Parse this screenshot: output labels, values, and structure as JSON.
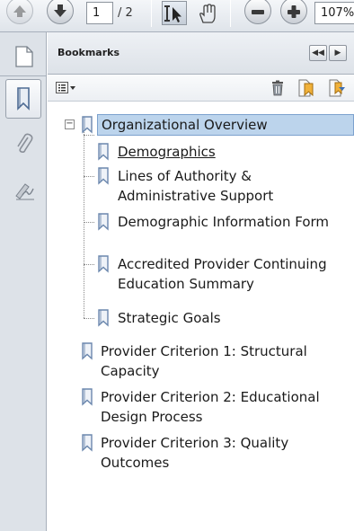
{
  "toolbar": {
    "page_number": "1",
    "page_total": "/ 2",
    "zoom": "107%"
  },
  "panel": {
    "title": "Bookmarks",
    "collapse_label": "◀◀",
    "expand_label": "▶"
  },
  "bookmarks": {
    "root": "Organizational Overview",
    "children": [
      {
        "lines": [
          "Demographics"
        ]
      },
      {
        "lines": [
          "Lines of Authority &",
          "Administrative Support"
        ]
      },
      {
        "lines": [
          "Demographic Information Form"
        ]
      },
      {
        "lines": [
          "Accredited Provider Continuing",
          "Education Summary"
        ]
      },
      {
        "lines": [
          "Strategic Goals"
        ]
      }
    ],
    "top_level": [
      {
        "lines": [
          "Provider Criterion 1: Structural",
          "Capacity"
        ]
      },
      {
        "lines": [
          "Provider Criterion 2: Educational",
          "Design Process"
        ]
      },
      {
        "lines": [
          "Provider Criterion 3: Quality",
          "Outcomes"
        ]
      }
    ]
  },
  "icons": {
    "prev": "arrow-up-icon",
    "next": "arrow-down-icon",
    "select": "select-cursor-icon",
    "hand": "hand-icon",
    "zoom_out": "minus-icon",
    "zoom_in": "plus-icon",
    "pages": "pages-icon",
    "bookmarks": "bookmark-icon",
    "attachments": "paperclip-icon",
    "signatures": "signature-icon",
    "delete": "trash-icon",
    "new_bookmark": "new-bookmark-icon",
    "expand_bookmark": "expand-bookmark-icon"
  },
  "colors": {
    "selection_bg": "#bcd4ec",
    "selection_border": "#7da2ce",
    "bookmark_icon": "#6b87ad"
  }
}
